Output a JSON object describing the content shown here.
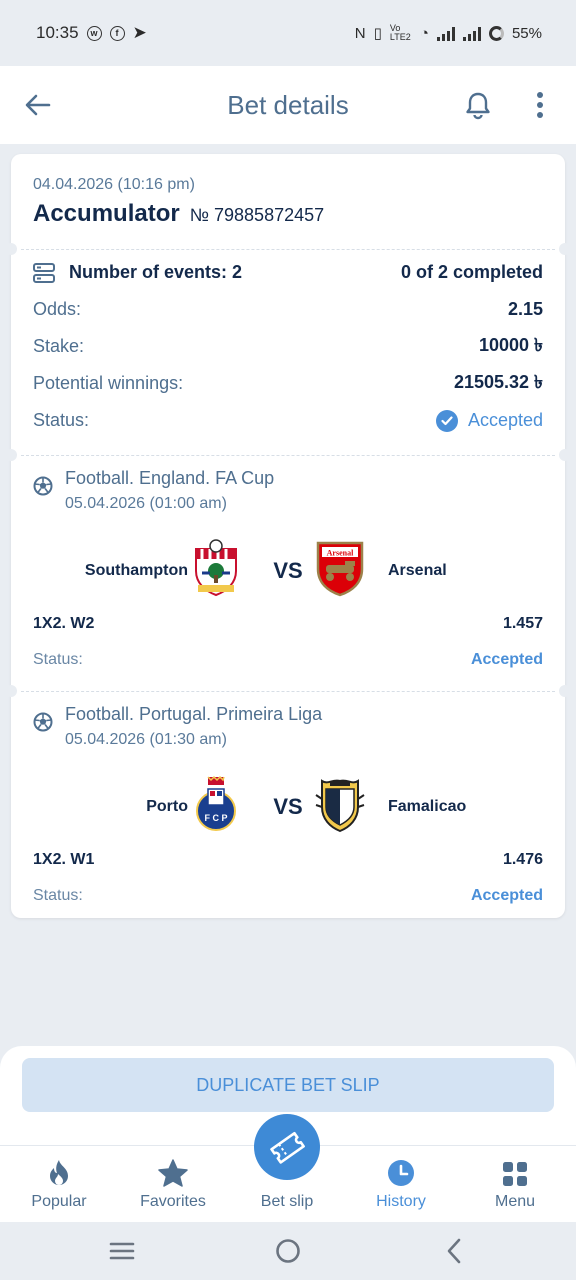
{
  "status_bar": {
    "time": "10:35",
    "battery": "55%",
    "network": "Vo LTE2"
  },
  "header": {
    "title": "Bet details",
    "back_icon": "arrow-left-icon",
    "bell_icon": "bell-icon",
    "more_icon": "more-vertical-icon"
  },
  "bet": {
    "date": "04.04.2026 (10:16 pm)",
    "type": "Accumulator",
    "number": "№ 79885872457",
    "events_label": "Number of events: 2",
    "completed": "0 of 2 completed",
    "odds_label": "Odds:",
    "odds": "2.15",
    "stake_label": "Stake:",
    "stake": "10000 ৳",
    "winnings_label": "Potential winnings:",
    "winnings": "21505.32 ৳",
    "status_label": "Status:",
    "status": "Accepted"
  },
  "events": [
    {
      "league": "Football. England. FA Cup",
      "date": "05.04.2026 (01:00 am)",
      "home": "Southampton",
      "away": "Arsenal",
      "vs": "VS",
      "market": "1X2. W2",
      "odds": "1.457",
      "status_label": "Status:",
      "status": "Accepted"
    },
    {
      "league": "Football. Portugal. Primeira Liga",
      "date": "05.04.2026 (01:30 am)",
      "home": "Porto",
      "away": "Famalicao",
      "vs": "VS",
      "market": "1X2. W1",
      "odds": "1.476",
      "status_label": "Status:",
      "status": "Accepted"
    }
  ],
  "actions": {
    "duplicate": "DUPLICATE BET SLIP"
  },
  "nav": {
    "popular": "Popular",
    "favorites": "Favorites",
    "bet_slip": "Bet slip",
    "history": "History",
    "menu": "Menu"
  },
  "colors": {
    "accent": "#4a8fd8",
    "title": "#13294b",
    "muted": "#4f6f8f",
    "background": "#e9edf2"
  }
}
